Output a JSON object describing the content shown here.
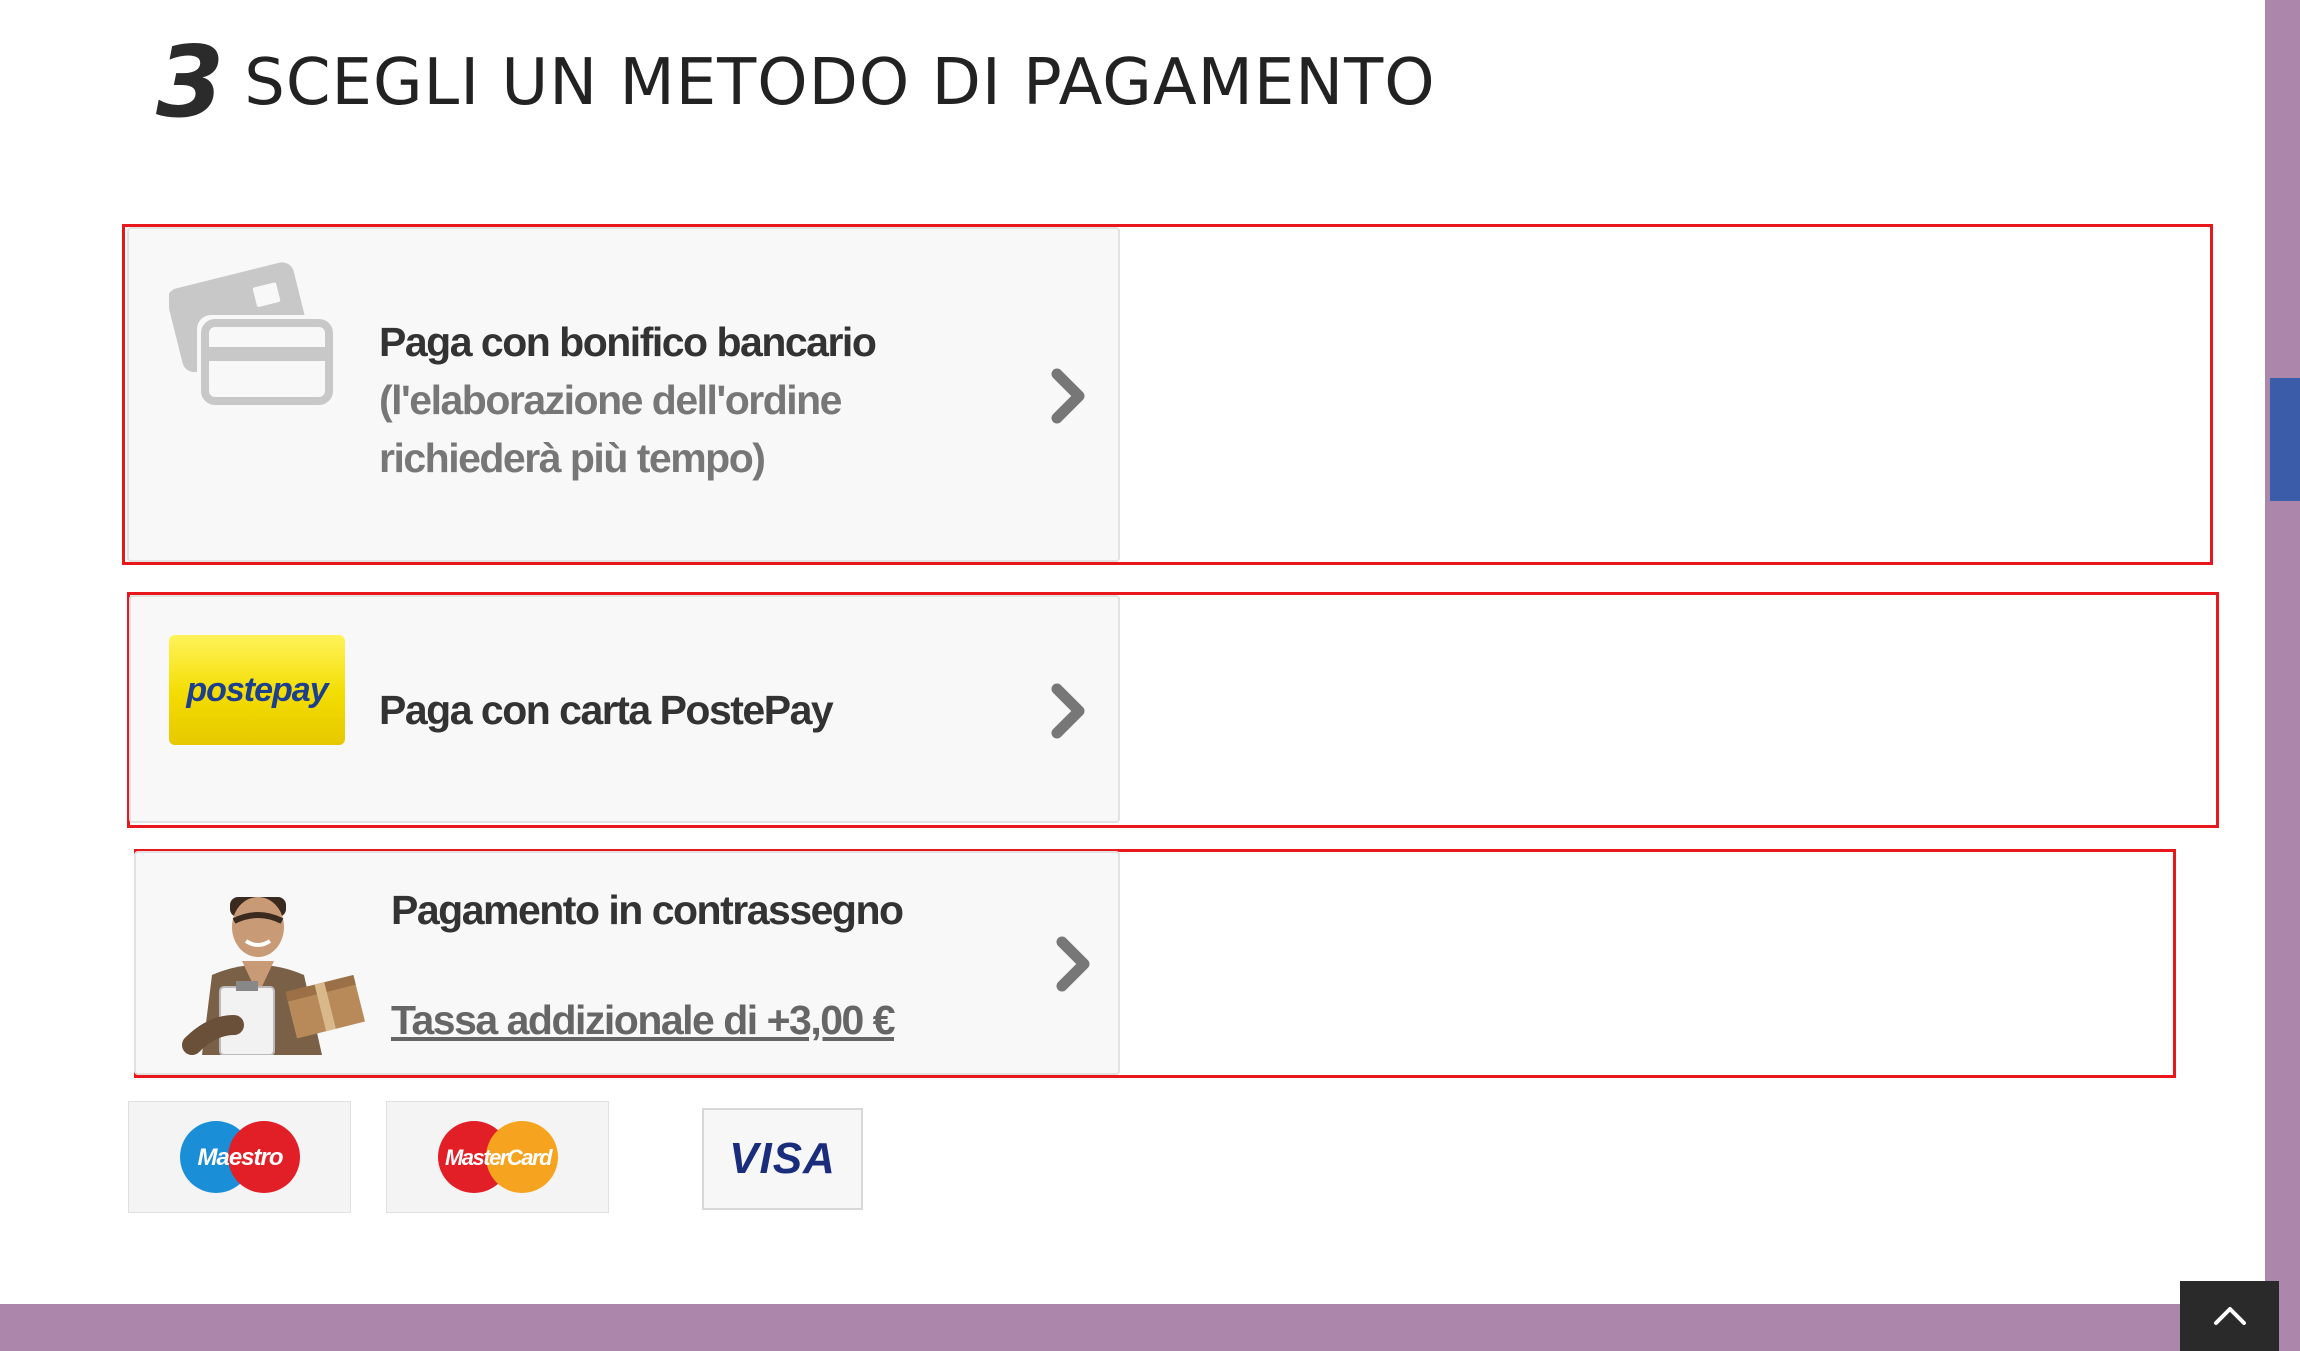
{
  "section": {
    "step_number": "3",
    "title": "SCEGLI UN METODO DI PAGAMENTO"
  },
  "payment_methods": [
    {
      "title": "Paga con bonifico bancario",
      "subtitle_line1": "(l'elaborazione dell'ordine",
      "subtitle_line2": "richiederà più tempo)",
      "icon": "credit-card-icon"
    },
    {
      "title": "Paga con carta PostePay",
      "logo_text": "postepay",
      "icon": "postepay-logo"
    },
    {
      "title": "Pagamento in contrassegno",
      "fee_link": "Tassa addizionale di +3,00 €",
      "icon": "courier-image"
    }
  ],
  "accepted_cards": [
    {
      "name": "Maestro",
      "label": "Maestro"
    },
    {
      "name": "MasterCard",
      "label": "MasterCard"
    },
    {
      "name": "Visa",
      "label": "VISA"
    }
  ],
  "colors": {
    "outline": "#e8171b",
    "side_band": "#ac86ab",
    "side_tab": "#3b5ca8",
    "heading": "#222222"
  },
  "icons": {
    "scroll_top": "chevron-up-icon",
    "card_arrow": "chevron-right-icon"
  }
}
